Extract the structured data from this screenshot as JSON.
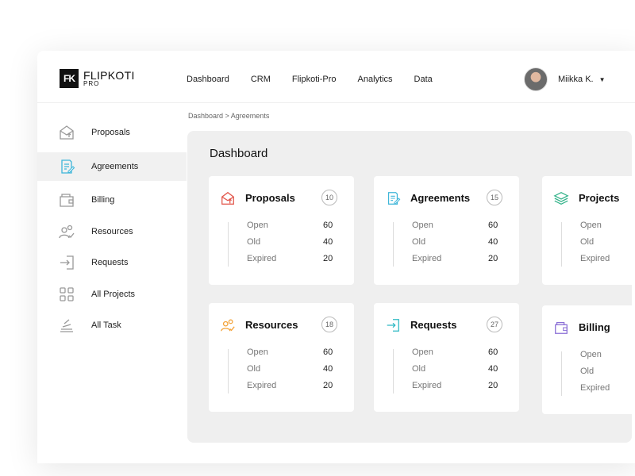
{
  "app": {
    "name": "FLIPKOTI",
    "sub": "PRO",
    "mark": "FK"
  },
  "nav": [
    "Dashboard",
    "CRM",
    "Flipkoti-Pro",
    "Analytics",
    "Data"
  ],
  "user": {
    "name": "Miikka K."
  },
  "sidebar": [
    {
      "label": "Proposals",
      "icon": "envelope-up-icon"
    },
    {
      "label": "Agreements",
      "icon": "document-edit-icon",
      "active": true
    },
    {
      "label": "Billing",
      "icon": "wallet-icon"
    },
    {
      "label": "Resources",
      "icon": "users-check-icon"
    },
    {
      "label": "Requests",
      "icon": "login-arrow-icon"
    },
    {
      "label": "All Projects",
      "icon": "grid-icon"
    },
    {
      "label": "All Task",
      "icon": "stack-icon"
    }
  ],
  "breadcrumb": "Dashboard > Agreements",
  "main": {
    "title": "Dashboard",
    "cards": [
      {
        "title": "Proposals",
        "count": "10",
        "icon": "envelope-up-icon",
        "color": "#e2574c",
        "rows": [
          {
            "label": "Open",
            "value": "60"
          },
          {
            "label": "Old",
            "value": "40"
          },
          {
            "label": "Expired",
            "value": "20"
          }
        ]
      },
      {
        "title": "Agreements",
        "count": "15",
        "icon": "document-edit-icon",
        "color": "#3fb6d9",
        "rows": [
          {
            "label": "Open",
            "value": "60"
          },
          {
            "label": "Old",
            "value": "40"
          },
          {
            "label": "Expired",
            "value": "20"
          }
        ]
      },
      {
        "title": "Projects",
        "count": "",
        "icon": "layers-icon",
        "color": "#33b38a",
        "rows": [
          {
            "label": "Open",
            "value": ""
          },
          {
            "label": "Old",
            "value": ""
          },
          {
            "label": "Expired",
            "value": ""
          }
        ]
      },
      {
        "title": "Resources",
        "count": "18",
        "icon": "users-check-icon",
        "color": "#f3a33a",
        "rows": [
          {
            "label": "Open",
            "value": "60"
          },
          {
            "label": "Old",
            "value": "40"
          },
          {
            "label": "Expired",
            "value": "20"
          }
        ]
      },
      {
        "title": "Requests",
        "count": "27",
        "icon": "login-arrow-icon",
        "color": "#2fb9c4",
        "rows": [
          {
            "label": "Open",
            "value": "60"
          },
          {
            "label": "Old",
            "value": "40"
          },
          {
            "label": "Expired",
            "value": "20"
          }
        ]
      },
      {
        "title": "Billing",
        "count": "",
        "icon": "wallet-icon",
        "color": "#8b6fd6",
        "rows": [
          {
            "label": "Open",
            "value": ""
          },
          {
            "label": "Old",
            "value": ""
          },
          {
            "label": "Expired",
            "value": ""
          }
        ]
      }
    ]
  }
}
